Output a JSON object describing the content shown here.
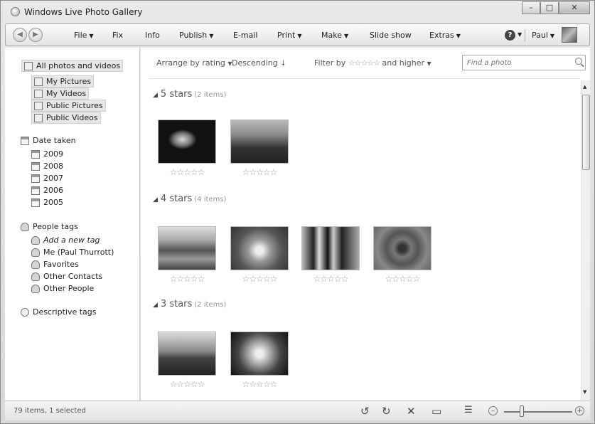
{
  "window": {
    "title": "Windows Live Photo Gallery"
  },
  "toolbar": {
    "menus": [
      {
        "label": "File",
        "dropdown": true
      },
      {
        "label": "Fix",
        "dropdown": false
      },
      {
        "label": "Info",
        "dropdown": false
      },
      {
        "label": "Publish",
        "dropdown": true
      },
      {
        "label": "E-mail",
        "dropdown": false
      },
      {
        "label": "Print",
        "dropdown": true
      },
      {
        "label": "Make",
        "dropdown": true
      },
      {
        "label": "Slide show",
        "dropdown": false
      },
      {
        "label": "Extras",
        "dropdown": true
      }
    ],
    "help_label": "?",
    "user_label": "Paul"
  },
  "sidebar": {
    "all_photos": "All photos and videos",
    "libraries": [
      "My Pictures",
      "My Videos",
      "Public Pictures",
      "Public Videos"
    ],
    "date_taken": "Date taken",
    "years": [
      "2009",
      "2008",
      "2007",
      "2006",
      "2005"
    ],
    "people_tags": "People tags",
    "people": [
      "Add a new tag",
      "Me (Paul Thurrott)",
      "Favorites",
      "Other Contacts",
      "Other People"
    ],
    "descriptive_tags": "Descriptive tags"
  },
  "view": {
    "arrange_label": "Arrange by rating",
    "order_label": "Descending",
    "filter_label": "Filter by",
    "filter_suffix": "and higher",
    "search_placeholder": "Find a photo"
  },
  "groups": [
    {
      "heading": "5 stars",
      "count_label": "(2 items)",
      "rating": 5,
      "photos": [
        "jellyfish",
        "castle"
      ]
    },
    {
      "heading": "4 stars",
      "count_label": "(4 items)",
      "rating": 4,
      "photos": [
        "tulips",
        "koala",
        "penguins",
        "chrysanthemum"
      ]
    },
    {
      "heading": "3 stars",
      "count_label": "(2 items)",
      "rating": 3,
      "photos": [
        "desert",
        "hydrangeas"
      ]
    }
  ],
  "statusbar": {
    "text": "79 items, 1 selected"
  },
  "icons": {
    "back": "back-arrow-icon",
    "forward": "forward-arrow-icon",
    "rotate_left": "rotate-left-icon",
    "rotate_right": "rotate-right-icon",
    "delete": "delete-icon",
    "slideshow": "slideshow-icon",
    "details": "details-view-icon",
    "zoom_out": "zoom-out-icon",
    "zoom_in": "zoom-in-icon"
  }
}
